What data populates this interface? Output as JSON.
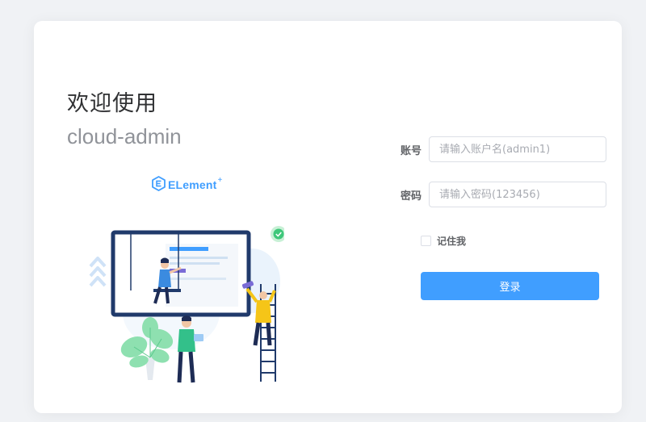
{
  "intro": {
    "welcome": "欢迎使用",
    "app_name": "cloud-admin",
    "brand": "ELement",
    "brand_sup": "+"
  },
  "form": {
    "account_label": "账号",
    "account_placeholder": "请输入账户名(admin1)",
    "account_value": "",
    "password_label": "密码",
    "password_placeholder": "请输入密码(123456)",
    "password_value": "",
    "remember_label": "记住我",
    "remember_checked": false,
    "login_label": "登录"
  },
  "colors": {
    "primary": "#409eff",
    "background": "#f0f2f5",
    "card": "#ffffff"
  },
  "icons": [
    "element-plus-logo",
    "teamwork-illustration",
    "check-badge-icon"
  ]
}
